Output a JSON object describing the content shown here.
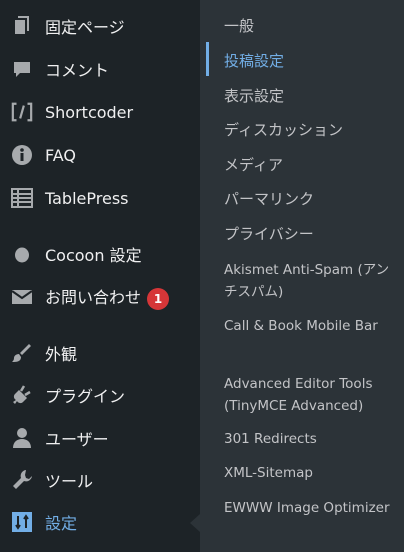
{
  "menu": {
    "items": [
      {
        "name": "pages",
        "label": "固定ページ",
        "icon": "page-icon"
      },
      {
        "name": "comments",
        "label": "コメント",
        "icon": "comment-icon"
      },
      {
        "name": "shortcoder",
        "label": "Shortcoder",
        "icon": "shortcode-icon"
      },
      {
        "name": "faq",
        "label": "FAQ",
        "icon": "info-icon"
      },
      {
        "name": "tablepress",
        "label": "TablePress",
        "icon": "table-icon"
      },
      {
        "name": "cocoon",
        "label": "Cocoon 設定",
        "icon": "circle-icon"
      },
      {
        "name": "contact",
        "label": "お問い合わせ",
        "icon": "mail-icon",
        "badge": "1"
      },
      {
        "name": "appearance",
        "label": "外観",
        "icon": "brush-icon"
      },
      {
        "name": "plugins",
        "label": "プラグイン",
        "icon": "plugin-icon"
      },
      {
        "name": "users",
        "label": "ユーザー",
        "icon": "user-icon"
      },
      {
        "name": "tools",
        "label": "ツール",
        "icon": "wrench-icon"
      },
      {
        "name": "settings",
        "label": "設定",
        "icon": "settings-icon",
        "current": true
      }
    ]
  },
  "submenu": {
    "items": [
      {
        "label": "一般"
      },
      {
        "label": "投稿設定",
        "active": true
      },
      {
        "label": "表示設定"
      },
      {
        "label": "ディスカッション"
      },
      {
        "label": "メディア"
      },
      {
        "label": "パーマリンク"
      },
      {
        "label": "プライバシー"
      },
      {
        "label": "Akismet Anti-Spam (アンチスパム)"
      },
      {
        "label": "Call & Book Mobile Bar"
      },
      {
        "label": "Advanced Editor Tools (TinyMCE Advanced)"
      },
      {
        "label": "301 Redirects"
      },
      {
        "label": "XML-Sitemap"
      },
      {
        "label": "EWWW Image Optimizer"
      }
    ]
  },
  "colors": {
    "menu_bg": "#1d2327",
    "submenu_bg": "#2c3338",
    "accent": "#72aee6",
    "badge": "#d63638"
  }
}
